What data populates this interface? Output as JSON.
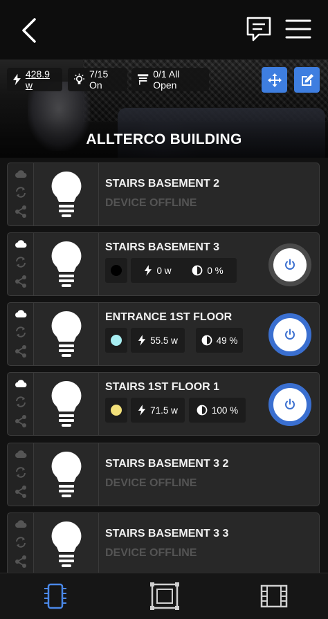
{
  "header": {
    "back_icon": "chevron-left-icon",
    "chat_icon": "chat-icon",
    "menu_icon": "hamburger-menu-icon"
  },
  "room": {
    "title": "ALLTERCO BUILDING",
    "power": "428.9 w",
    "lights": "7/15 On",
    "shutters": "0/1 All Open"
  },
  "devices": [
    {
      "name": "STAIRS BASEMENT 2",
      "status": "DEVICE OFFLINE"
    },
    {
      "name": "STAIRS BASEMENT 3",
      "power": "0 w",
      "brightness": "0 %",
      "color": "#000000",
      "state": "off"
    },
    {
      "name": "ENTRANCE 1ST FLOOR",
      "power": "55.5 w",
      "brightness": "49 %",
      "color": "#a8eef2",
      "state": "on"
    },
    {
      "name": "STAIRS 1ST FLOOR 1",
      "power": "71.5 w",
      "brightness": "100 %",
      "color": "#f2e07a",
      "state": "on"
    },
    {
      "name": "STAIRS BASEMENT 3 2",
      "status": "DEVICE OFFLINE"
    },
    {
      "name": "STAIRS BASEMENT 3 3",
      "status": "DEVICE OFFLINE"
    }
  ],
  "tabs": [
    {
      "icon": "chip-icon",
      "active": true
    },
    {
      "icon": "rooms-icon",
      "active": false
    },
    {
      "icon": "film-icon",
      "active": false
    }
  ],
  "colors": {
    "accent": "#3e7ee0",
    "active_tab": "#4a88e8"
  }
}
